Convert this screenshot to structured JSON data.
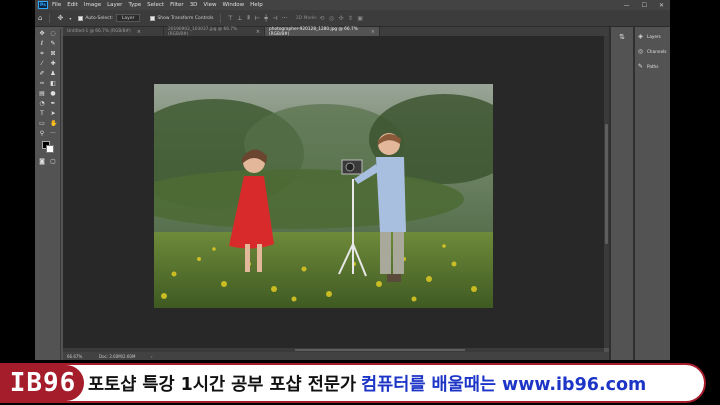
{
  "app": {
    "logo_text": "Ps",
    "menu": [
      "File",
      "Edit",
      "Image",
      "Layer",
      "Type",
      "Select",
      "Filter",
      "3D",
      "View",
      "Window",
      "Help"
    ],
    "window_controls": [
      "—",
      "☐",
      "✕"
    ]
  },
  "options_bar": {
    "auto_select_label": "Auto-Select:",
    "auto_select_target": "Layer",
    "transform_controls_label": "Show Transform Controls",
    "mode_3d_label": "3D Mode:"
  },
  "tabs": [
    {
      "label": "Untitled-1 @ 66.7% (RGB/8#)",
      "close": "×",
      "active": false
    },
    {
      "label": "20190902_103037.jpg @ 66.7% (RGB/8#)",
      "close": "×",
      "active": false
    },
    {
      "label": "photographer-920128_1280.jpg @ 66.7% (RGB/8#)",
      "close": "×",
      "active": true
    }
  ],
  "status_bar": {
    "zoom": "66.67%",
    "doc_size": "Doc: 2.60M/2.60M",
    "arrow": "›"
  },
  "panels": {
    "layers": "Layers",
    "channels": "Channels",
    "paths": "Paths"
  },
  "banner": {
    "brand": "IB96",
    "caption_black": "포토샵 특강 1시간 공부 포샵 전문가",
    "caption_blue": "컴퓨터를 배울때는 www.ib96.com"
  },
  "colors": {
    "banner_red": "#a51c2b",
    "caption_blue": "#1d35c7",
    "ps_blue": "#31a8ff"
  }
}
